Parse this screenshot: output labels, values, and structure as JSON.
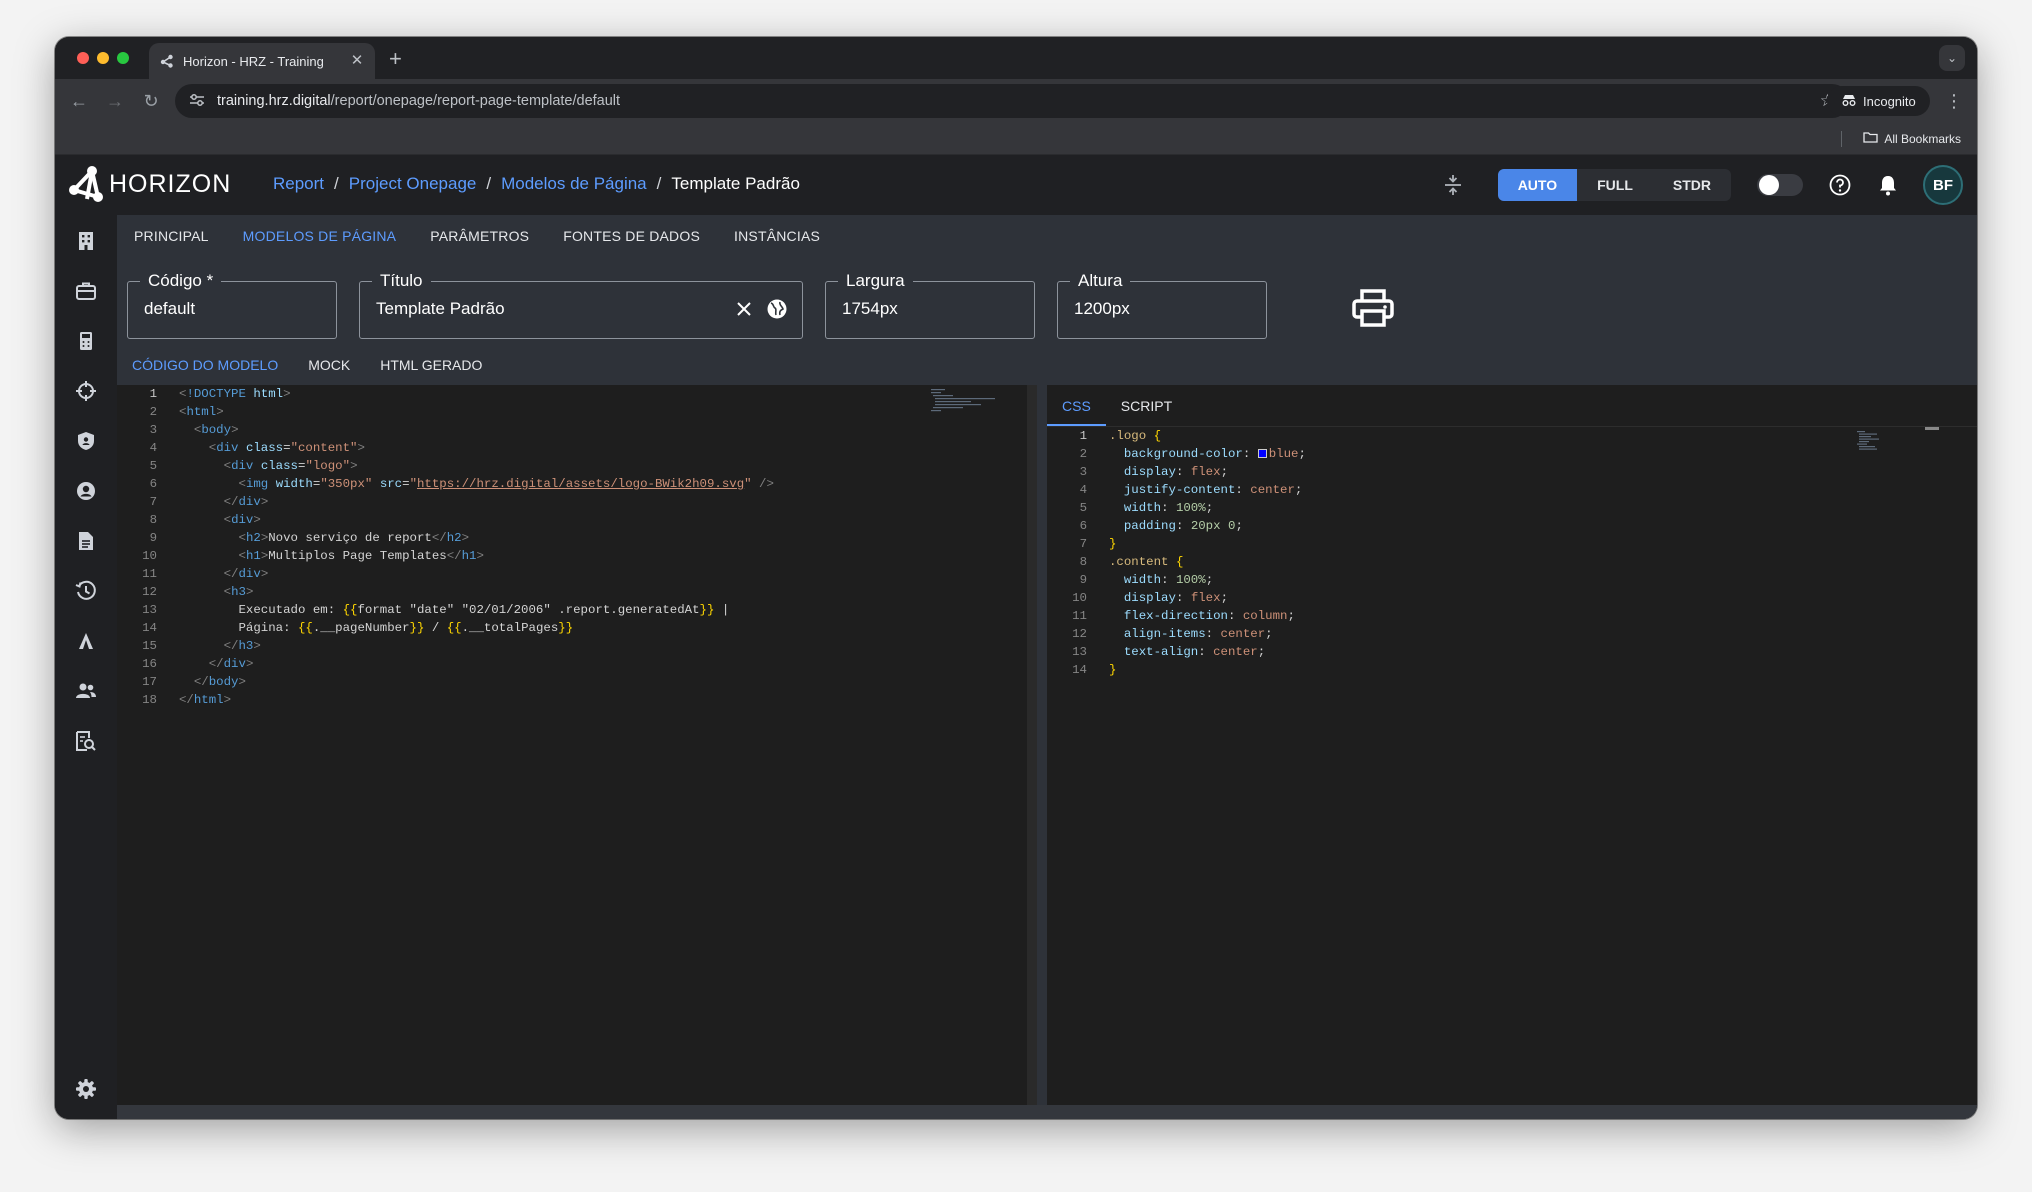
{
  "browser": {
    "tab_title": "Horizon - HRZ - Training",
    "url_host": "training.hrz.digital",
    "url_path": "/report/onepage/report-page-template/default",
    "incognito_label": "Incognito",
    "bookmarks_label": "All Bookmarks"
  },
  "app": {
    "logo_text": "HORIZON",
    "breadcrumb": [
      {
        "label": "Report"
      },
      {
        "label": "Project Onepage"
      },
      {
        "label": "Modelos de Página"
      },
      {
        "label": "Template Padrão"
      }
    ],
    "view_modes": [
      "AUTO",
      "FULL",
      "STDR"
    ],
    "view_mode_active": "AUTO",
    "avatar_initials": "BF",
    "accent_color": "#4a86e8"
  },
  "main_tabs": [
    "PRINCIPAL",
    "MODELOS DE PÁGINA",
    "PARÂMETROS",
    "FONTES DE DADOS",
    "INSTÂNCIAS"
  ],
  "main_tab_active": "MODELOS DE PÁGINA",
  "form": {
    "codigo": {
      "label": "Código *",
      "value": "default"
    },
    "titulo": {
      "label": "Título",
      "value": "Template Padrão"
    },
    "largura": {
      "label": "Largura",
      "value": "1754px"
    },
    "altura": {
      "label": "Altura",
      "value": "1200px"
    }
  },
  "sub_tabs": [
    "CÓDIGO DO MODELO",
    "MOCK",
    "HTML GERADO"
  ],
  "sub_tab_active": "CÓDIGO DO MODELO",
  "right_tabs": [
    "CSS",
    "SCRIPT"
  ],
  "right_tab_active": "CSS",
  "html_code": [
    "<!DOCTYPE html>",
    "<html>",
    "  <body>",
    "    <div class=\"content\">",
    "      <div class=\"logo\">",
    "        <img width=\"350px\" src=\"https://hrz.digital/assets/logo-BWik2h09.svg\" />",
    "      </div>",
    "      <div>",
    "        <h2>Novo serviço de report</h2>",
    "        <h1>Multiplos Page Templates</h1>",
    "      </div>",
    "      <h3>",
    "        Executado em: {{format \"date\" \"02/01/2006\" .report.generatedAt}} |",
    "        Página: {{.__pageNumber}} / {{.__totalPages}}",
    "      </h3>",
    "    </div>",
    "  </body>",
    "</html>"
  ],
  "css_code": [
    ".logo {",
    "  background-color: blue;",
    "  display: flex;",
    "  justify-content: center;",
    "  width: 100%;",
    "  padding: 20px 0;",
    "}",
    ".content {",
    "  width: 100%;",
    "  display: flex;",
    "  flex-direction: column;",
    "  align-items: center;",
    "  text-align: center;",
    "}"
  ]
}
